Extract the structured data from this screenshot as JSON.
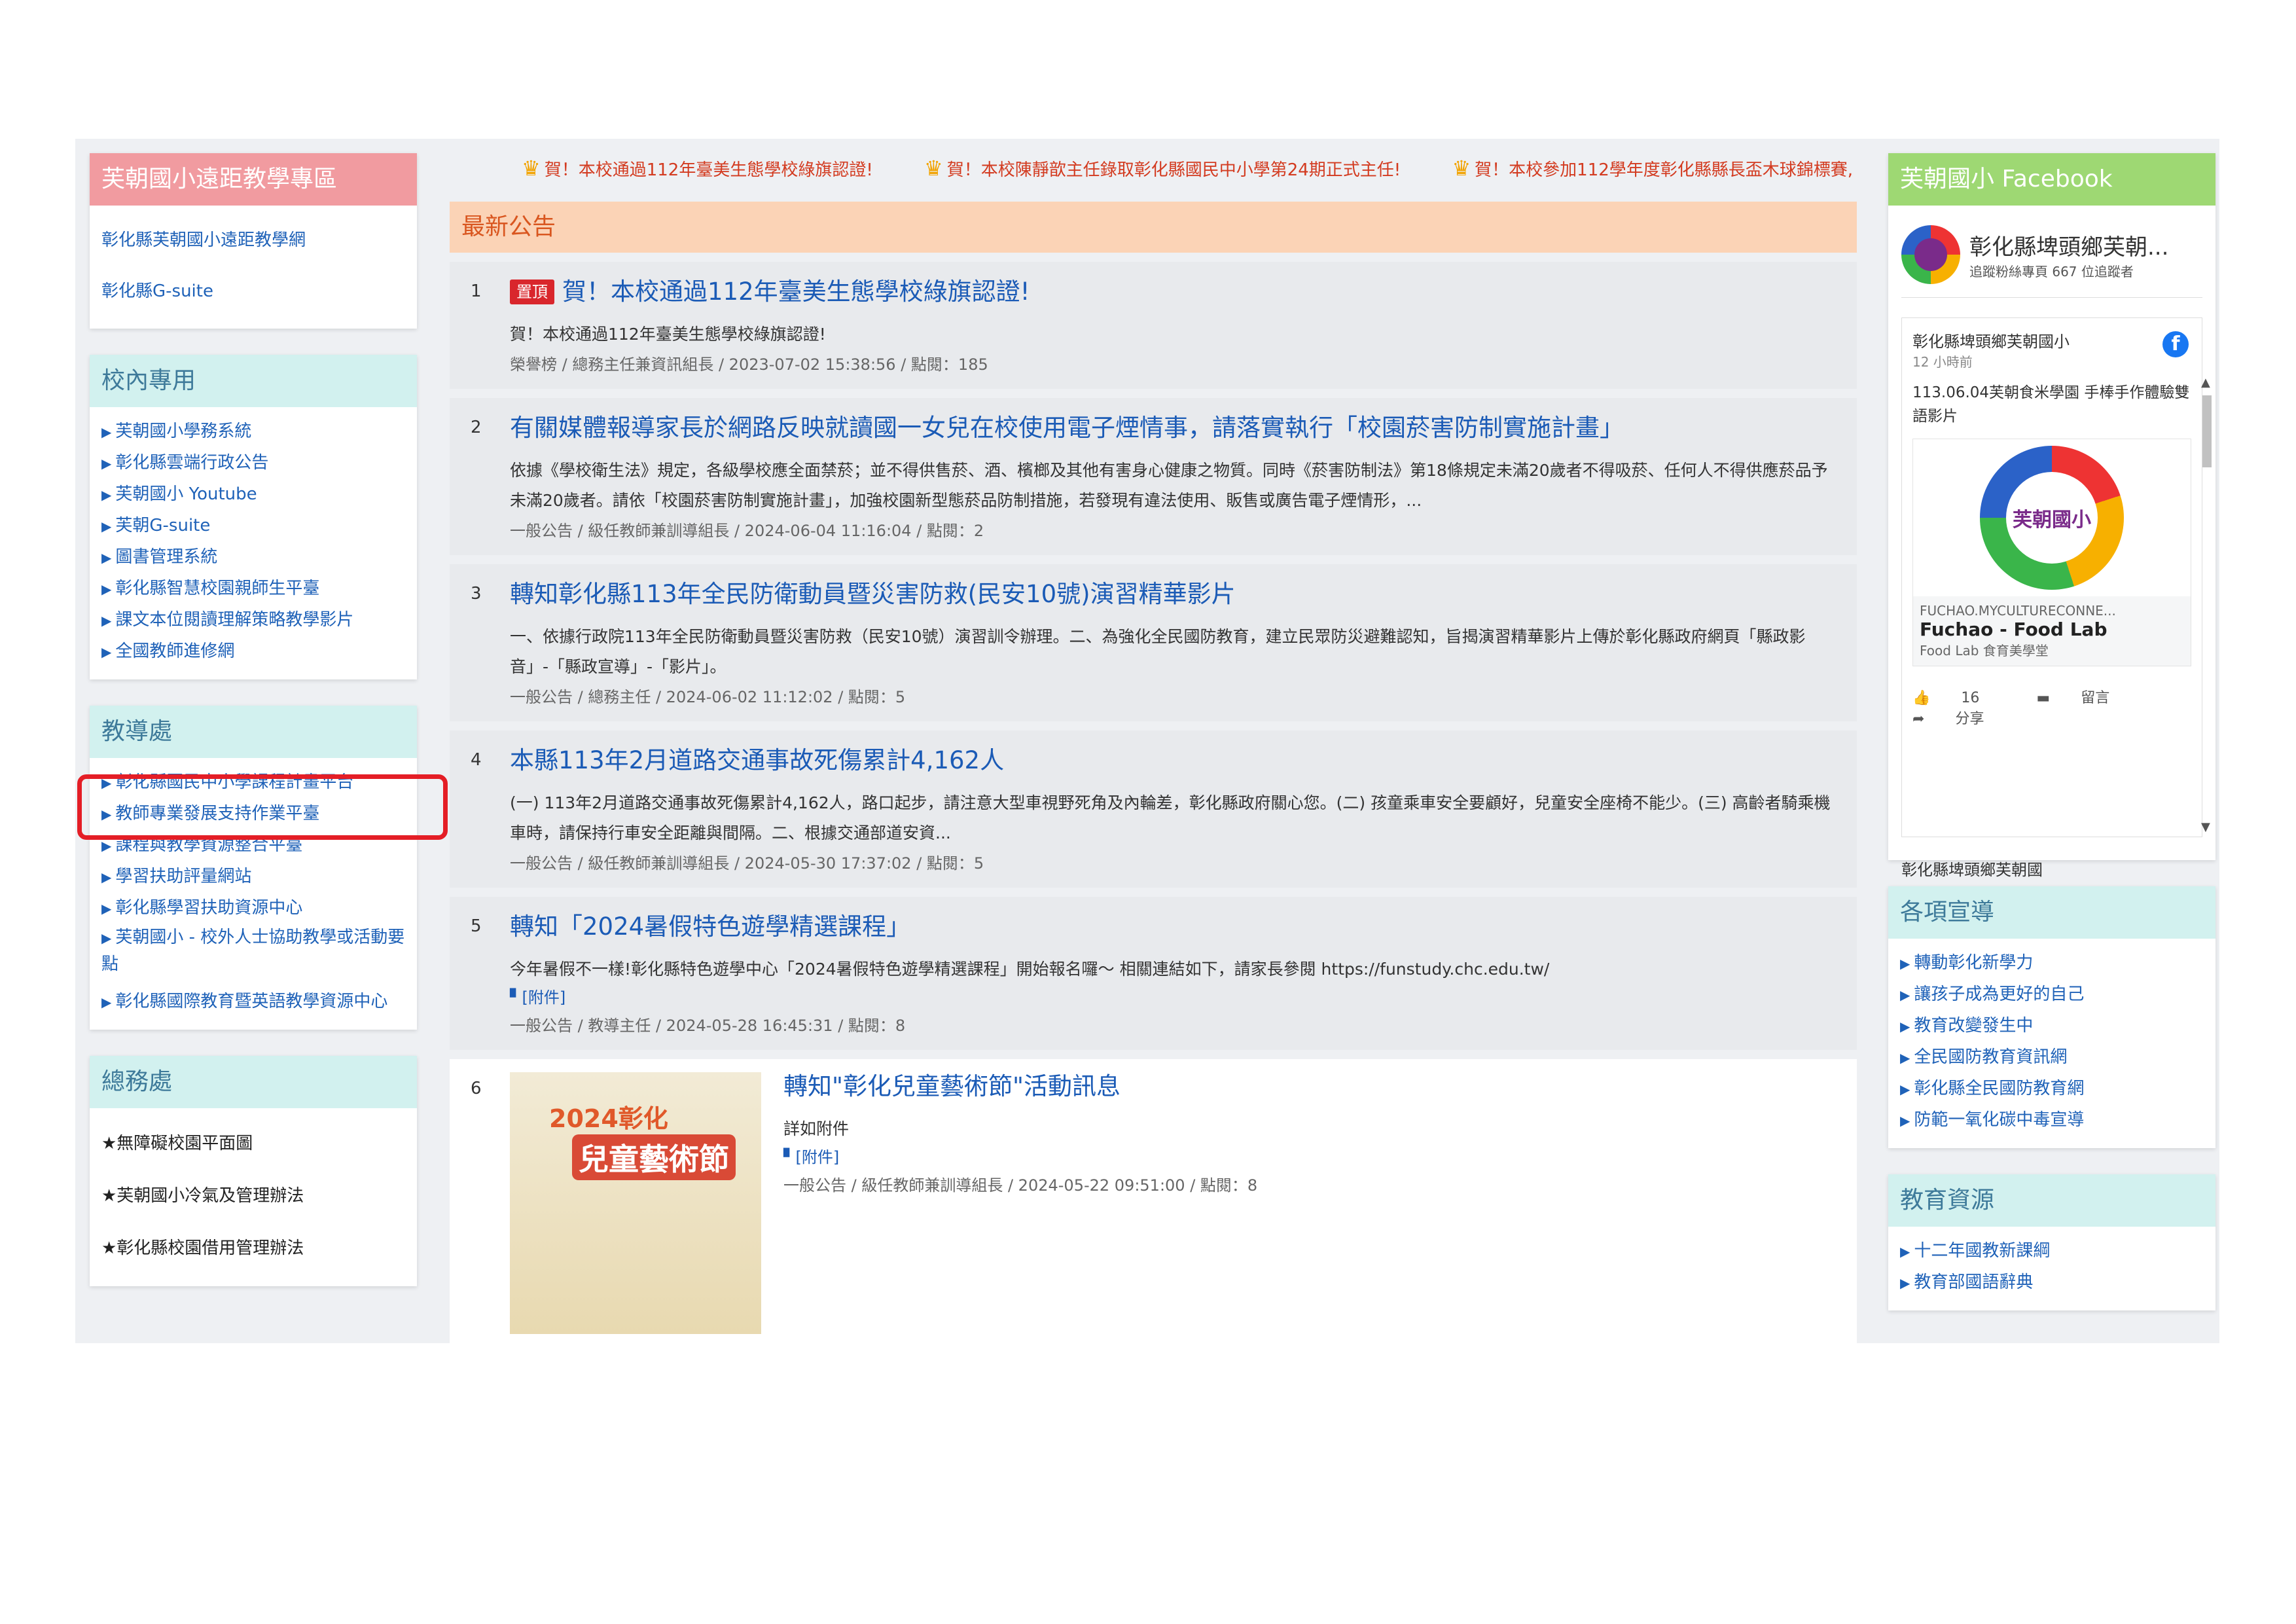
{
  "left": {
    "remote": {
      "title": "芙朝國小遠距教學專區",
      "items": [
        "彰化縣芙朝國小遠距教學網",
        "彰化縣G-suite"
      ]
    },
    "internal": {
      "title": "校內專用",
      "items": [
        "芙朝國小學務系統",
        "彰化縣雲端行政公告",
        "芙朝國小 Youtube",
        "芙朝G-suite",
        "圖書管理系統",
        "彰化縣智慧校園親師生平臺",
        "課文本位閱讀理解策略教學影片",
        "全國教師進修網"
      ]
    },
    "academic": {
      "title": "教導處",
      "items": [
        "彰化縣國民中小學課程計畫平台",
        "教師專業發展支持作業平臺",
        "課程與教學資源整合平臺",
        "學習扶助評量網站",
        "彰化縣學習扶助資源中心",
        "芙朝國小 - 校外人士協助教學或活動要點",
        "彰化縣國際教育暨英語教學資源中心"
      ]
    },
    "general": {
      "title": "總務處",
      "items": [
        "★無障礙校園平面圖",
        "★芙朝國小冷氣及管理辦法",
        "★彰化縣校園借用管理辦法"
      ]
    }
  },
  "marquee": [
    "賀！本校通過112年臺美生態學校綠旗認證!",
    "賀！本校陳靜歆主任錄取彰化縣國民中小學第24期正式主任!",
    "賀！本校參加112學年度彰化縣縣長盃木球錦標賽,"
  ],
  "news": {
    "title": "最新公告",
    "items": [
      {
        "num": "1",
        "badge": "置頂",
        "title": "賀！本校通過112年臺美生態學校綠旗認證!",
        "summary": "賀！本校通過112年臺美生態學校綠旗認證!",
        "meta": "榮譽榜 / 總務主任兼資訊組長 / 2023-07-02 15:38:56 / 點閱：185"
      },
      {
        "num": "2",
        "title": "有關媒體報導家長於網路反映就讀國一女兒在校使用電子煙情事，請落實執行「校園菸害防制實施計畫」",
        "summary": "依據《學校衛生法》規定，各級學校應全面禁菸；並不得供售菸、酒、檳榔及其他有害身心健康之物質。同時《菸害防制法》第18條規定未滿20歲者不得吸菸、任何人不得供應菸品予未滿20歲者。請依「校園菸害防制實施計畫」，加強校園新型態菸品防制措施，若發現有違法使用、販售或廣告電子煙情形，...",
        "meta": "一般公告 / 級任教師兼訓導組長 / 2024-06-04 11:16:04 / 點閱：2"
      },
      {
        "num": "3",
        "title": "轉知彰化縣113年全民防衛動員暨災害防救(民安10號)演習精華影片",
        "summary": "一、依據行政院113年全民防衛動員暨災害防救（民安10號）演習訓令辦理。二、為強化全民國防教育，建立民眾防災避難認知，旨揭演習精華影片上傳於彰化縣政府網頁「縣政影音」-「縣政宣導」-「影片」。",
        "meta": "一般公告 / 總務主任 / 2024-06-02 11:12:02 / 點閱：5"
      },
      {
        "num": "4",
        "title": "本縣113年2月道路交通事故死傷累計4,162人",
        "summary": "(一) 113年2月道路交通事故死傷累計4,162人，路口起步，請注意大型車視野死角及內輪差，彰化縣政府關心您。(二) 孩童乘車安全要顧好，兒童安全座椅不能少。(三) 高齡者騎乘機車時，請保持行車安全距離與間隔。二、根據交通部道安資...",
        "meta": "一般公告 / 級任教師兼訓導組長 / 2024-05-30 17:37:02 / 點閱：5"
      },
      {
        "num": "5",
        "title": "轉知「2024暑假特色遊學精選課程」",
        "summary": "今年暑假不一樣!彰化縣特色遊學中心「2024暑假特色遊學精選課程」開始報名囉～ 相關連結如下，請家長參閱 https://funstudy.chc.edu.tw/",
        "attach": "[附件]",
        "meta": "一般公告 / 教導主任 / 2024-05-28 16:45:31 / 點閱：8"
      },
      {
        "num": "6",
        "title": "轉知\"彰化兒童藝術節\"活動訊息",
        "summary": "詳如附件",
        "attach": "[附件]",
        "meta": "一般公告 / 級任教師兼訓導組長 / 2024-05-22 09:51:00 / 點閱：8",
        "poster_line1": "2024彰化",
        "poster_line2": "兒童藝術節"
      }
    ]
  },
  "facebook": {
    "title": "芙朝國小 Facebook",
    "page_name": "彰化縣埤頭鄉芙朝...",
    "page_sub": "追蹤粉絲專頁  667 位追蹤者",
    "post_name": "彰化縣埤頭鄉芙朝國小",
    "post_time": "12 小時前",
    "post_text": "113.06.04芙朝食米學園 手棒手作體驗雙語影片",
    "card_logo": "芙朝國小",
    "card_domain": "FUCHAO.MYCULTURECONNE...",
    "card_title": "Fuchao - Food Lab",
    "card_sub": "Food Lab 食育美學堂",
    "likes": "16",
    "comment": "留言",
    "share": "分享",
    "next_post_name": "彰化縣埤頭鄉芙朝國"
  },
  "advocacy": {
    "title": "各項宣導",
    "items": [
      "轉動彰化新學力",
      "讓孩子成為更好的自己",
      "教育改變發生中",
      "全民國防教育資訊網",
      "彰化縣全民國防教育網",
      "防範一氧化碳中毒宣導"
    ]
  },
  "resources": {
    "title": "教育資源",
    "items": [
      "十二年國教新課綱",
      "教育部國語辭典"
    ]
  },
  "colors": {
    "pink_header": "#f19ba0",
    "mint_header": "#d2f1ef",
    "green_header": "#9ed873",
    "news_header": "#fbd3b6",
    "link": "#1f62b8",
    "highlight": "#e41e26"
  }
}
